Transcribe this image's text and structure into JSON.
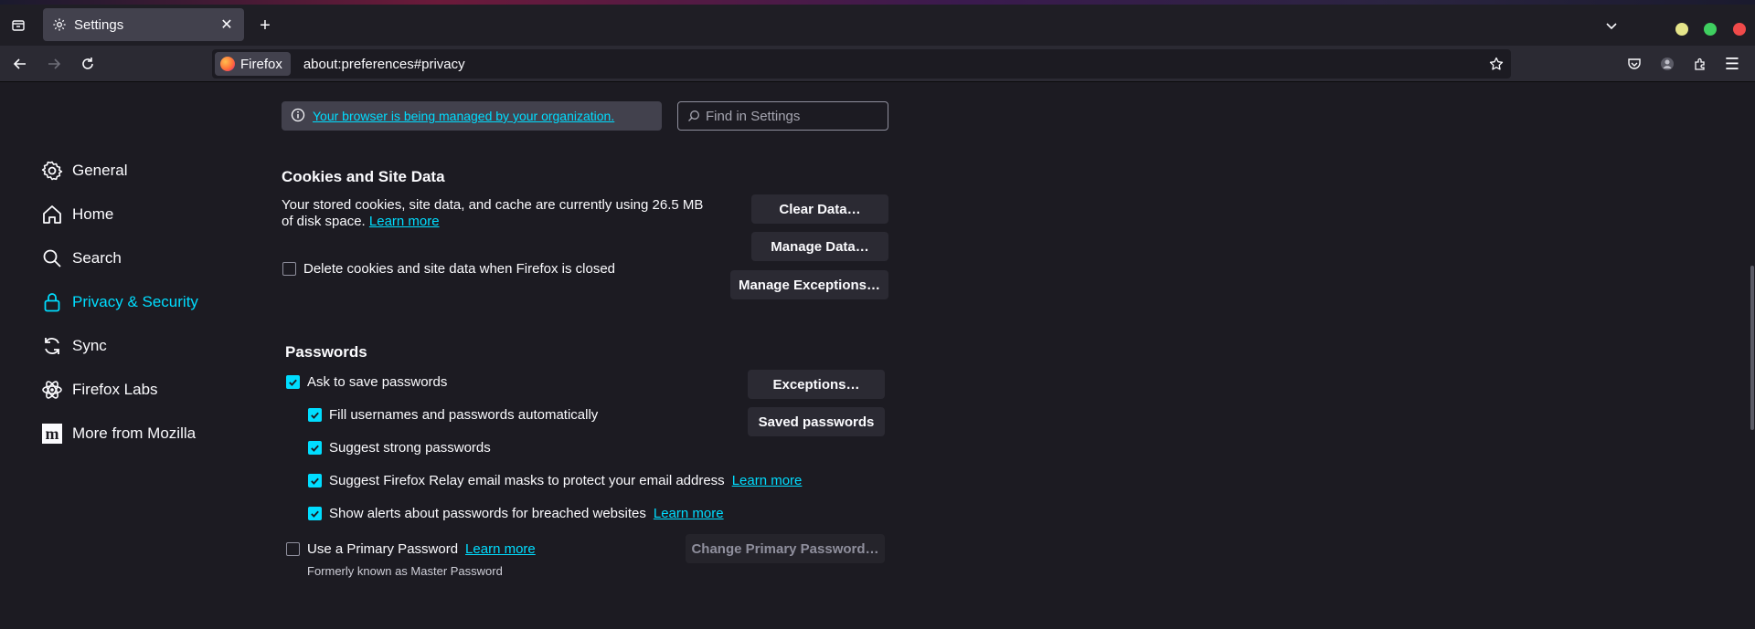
{
  "tab": {
    "title": "Settings"
  },
  "urlbar": {
    "identity": "Firefox",
    "url": "about:preferences#privacy"
  },
  "colors": {
    "accent": "#00ddff",
    "window_yellow": "#e5e58a",
    "window_green": "#3fcf60",
    "window_red": "#f04a4a"
  },
  "banner": {
    "managed_text": "Your browser is being managed by your organization."
  },
  "search": {
    "placeholder": "Find in Settings"
  },
  "sidebar": {
    "items": [
      {
        "label": "General",
        "icon": "gear-icon"
      },
      {
        "label": "Home",
        "icon": "home-icon"
      },
      {
        "label": "Search",
        "icon": "search-icon"
      },
      {
        "label": "Privacy & Security",
        "icon": "lock-icon",
        "active": true
      },
      {
        "label": "Sync",
        "icon": "sync-icon"
      },
      {
        "label": "Firefox Labs",
        "icon": "labs-icon"
      },
      {
        "label": "More from Mozilla",
        "icon": "mozilla-icon"
      }
    ]
  },
  "cookies": {
    "heading": "Cookies and Site Data",
    "desc_line1": "Your stored cookies, site data, and cache are currently using 26.5 MB",
    "desc_line2": "of disk space.",
    "learn_more": "Learn more",
    "delete_on_close": {
      "label": "Delete cookies and site data when Firefox is closed",
      "checked": false
    },
    "clear_data": "Clear Data…",
    "manage_data": "Manage Data…",
    "manage_exceptions": "Manage Exceptions…"
  },
  "passwords": {
    "heading": "Passwords",
    "ask_to_save": {
      "label": "Ask to save passwords",
      "checked": true
    },
    "fill_auto": {
      "label": "Fill usernames and passwords automatically",
      "checked": true
    },
    "suggest_strong": {
      "label": "Suggest strong passwords",
      "checked": true
    },
    "relay": {
      "label": "Suggest Firefox Relay email masks to protect your email address",
      "checked": true,
      "link": "Learn more"
    },
    "breach_alerts": {
      "label": "Show alerts about passwords for breached websites",
      "checked": true,
      "link": "Learn more"
    },
    "primary_password": {
      "label": "Use a Primary Password",
      "checked": false,
      "link": "Learn more"
    },
    "primary_note": "Formerly known as Master Password",
    "exceptions": "Exceptions…",
    "saved_passwords": "Saved passwords",
    "change_primary": "Change Primary Password…"
  }
}
